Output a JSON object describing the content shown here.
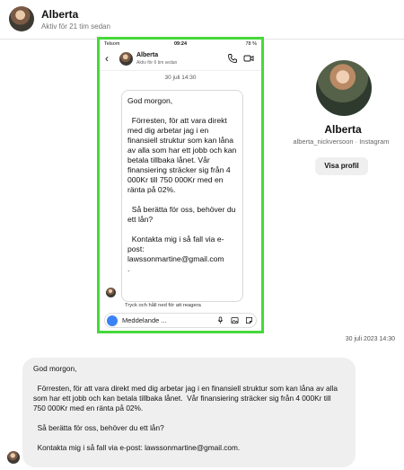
{
  "header": {
    "name": "Alberta",
    "status": "Aktiv för 21 tim sedan"
  },
  "phone": {
    "status_left": "Telsom",
    "status_time": "09:24",
    "status_right": "78 %",
    "name": "Alberta",
    "status": "Aktiv för 6 tim sedan",
    "date": "30 juli 14:30",
    "message": "God morgon,\n\n  Förresten, för att vara direkt med dig arbetar jag i en finansiell struktur som kan låna av alla som har ett jobb och kan betala tillbaka lånet. Vår finansiering sträcker sig från 4 000Kr till 750 000Kr med en ränta på 02%.\n\n  Så berätta för oss, behöver du ett lån?\n\n  Kontakta mig i så fall via e-post: lawssonmartine@gmail.com\n.",
    "hint": "Tryck och håll ned för att reagera",
    "input_placeholder": "Meddelande ..."
  },
  "profile": {
    "name": "Alberta",
    "username": "alberta_nickversoon · Instagram",
    "button": "Visa profil"
  },
  "conversation": {
    "timestamp": "30 juli 2023 14:30",
    "message": "God morgon,\n\n  Förresten, för att vara direkt med dig arbetar jag i en finansiell struktur som kan låna av alla som har ett jobb och kan betala tillbaka lånet.  Vår finansiering sträcker sig från 4 000Kr till 750 000Kr med en ränta på 02%.\n\n  Så berätta för oss, behöver du ett lån?\n\n  Kontakta mig i så fall via e-post: lawssonmartine@gmail.com."
  },
  "colors": {
    "highlight_border": "#46d93a",
    "bubble_bg": "#efefef",
    "camera_button": "#3b82f6"
  }
}
